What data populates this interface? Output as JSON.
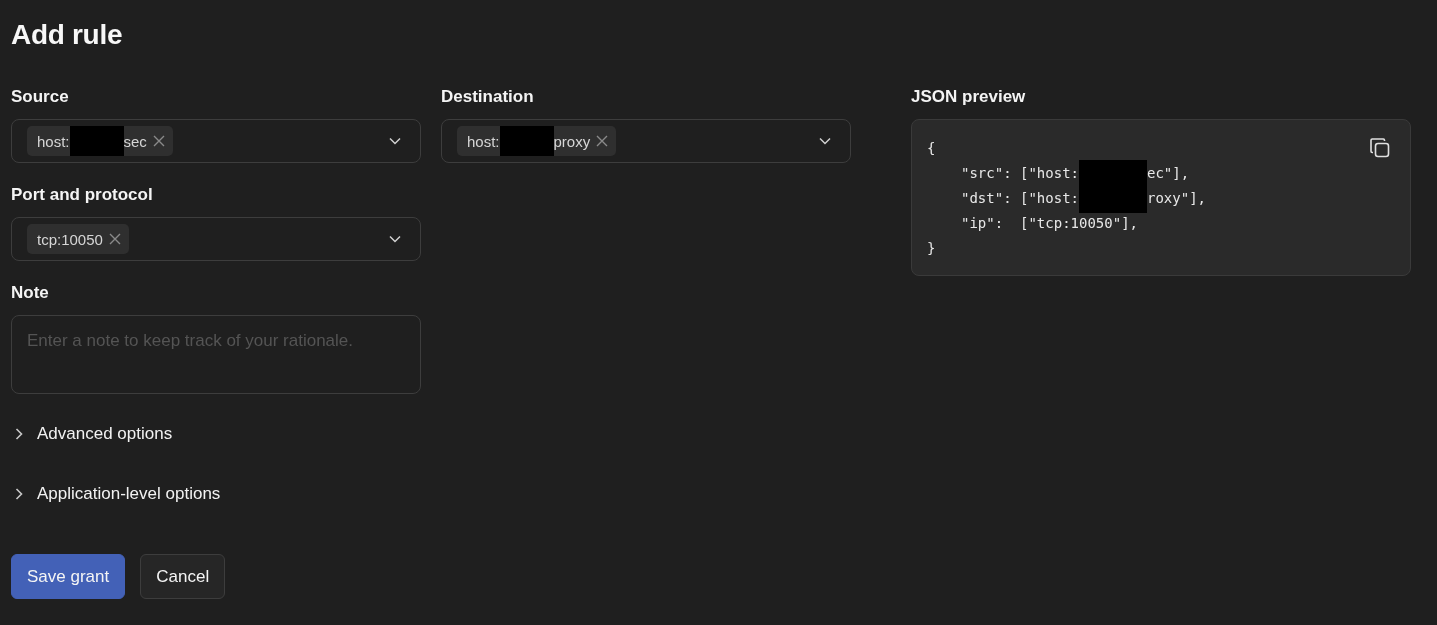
{
  "page": {
    "title": "Add rule"
  },
  "source": {
    "label": "Source",
    "tags": [
      {
        "parts": [
          "host:",
          "sec"
        ]
      }
    ]
  },
  "destination": {
    "label": "Destination",
    "tags": [
      {
        "parts": [
          "host:",
          "proxy"
        ]
      }
    ]
  },
  "json_preview": {
    "label": "JSON preview",
    "lines": [
      {
        "kind": "brace",
        "parts": [
          "{"
        ]
      },
      {
        "kind": "entry",
        "parts": [
          "\"src\": [\"host:",
          "ec\"],"
        ]
      },
      {
        "kind": "entry",
        "parts": [
          "\"dst\": [\"host:",
          "roxy\"],"
        ]
      },
      {
        "kind": "entry",
        "parts": [
          "\"ip\":  [\"tcp:10050\"],"
        ]
      },
      {
        "kind": "brace",
        "parts": [
          "}"
        ]
      }
    ]
  },
  "port_and_protocol": {
    "label": "Port and protocol",
    "tags": [
      {
        "parts": [
          "tcp:10050"
        ]
      }
    ]
  },
  "note": {
    "label": "Note",
    "placeholder": "Enter a note to keep track of your rationale."
  },
  "sections": [
    {
      "label": "Advanced options",
      "expanded": false
    },
    {
      "label": "Application-level options",
      "expanded": false
    }
  ],
  "buttons": [
    {
      "label": "Save grant",
      "kind": "primary"
    },
    {
      "label": "Cancel",
      "kind": "secondary"
    }
  ]
}
